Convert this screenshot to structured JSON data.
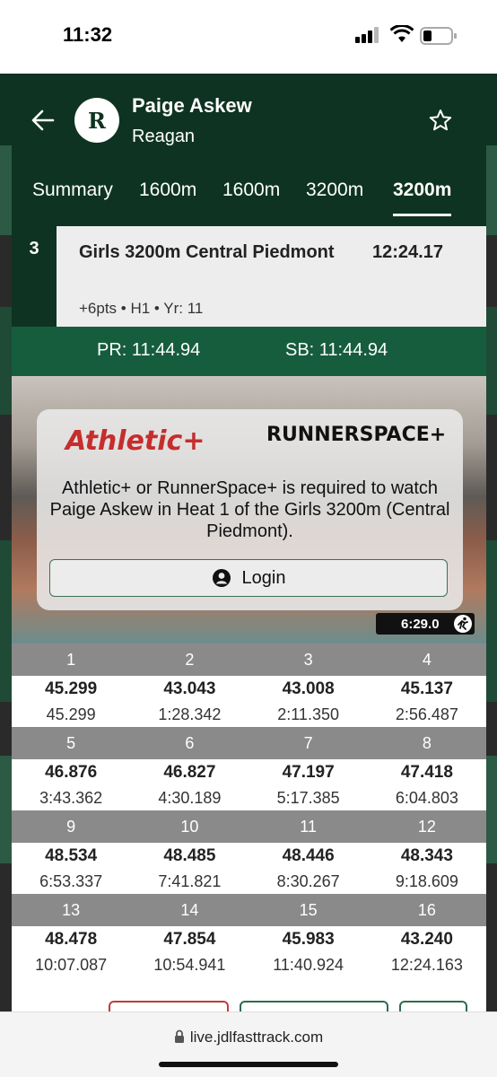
{
  "status_bar": {
    "time": "11:32"
  },
  "header": {
    "athlete_name": "Paige Askew",
    "team": "Reagan",
    "logo_letter": "R"
  },
  "tabs": [
    {
      "label": "Summary",
      "active": false
    },
    {
      "label": "1600m",
      "active": false
    },
    {
      "label": "1600m",
      "active": false
    },
    {
      "label": "3200m",
      "active": false
    },
    {
      "label": "3200m",
      "active": true
    }
  ],
  "result": {
    "place": "3",
    "event": "Girls 3200m Central Piedmont",
    "time": "12:24.17",
    "meta": "+6pts • H1 • Yr: 11"
  },
  "records": {
    "pr": "PR: 11:44.94",
    "sb": "SB: 11:44.94"
  },
  "video": {
    "athletic_logo": "Athletic+",
    "runnerspace_logo": "RUNNERSPACE+",
    "paywall_message": "Athletic+ or RunnerSpace+ is required to watch Paige Askew in  Heat 1 of the Girls 3200m (Central Piedmont).",
    "login_label": "Login",
    "duration": "6:29.0"
  },
  "splits": [
    {
      "laps": [
        "1",
        "2",
        "3",
        "4"
      ],
      "lap_times": [
        "45.299",
        "43.043",
        "43.008",
        "45.137"
      ],
      "cumulative": [
        "45.299",
        "1:28.342",
        "2:11.350",
        "2:56.487"
      ]
    },
    {
      "laps": [
        "5",
        "6",
        "7",
        "8"
      ],
      "lap_times": [
        "46.876",
        "46.827",
        "47.197",
        "47.418"
      ],
      "cumulative": [
        "3:43.362",
        "4:30.189",
        "5:17.385",
        "6:04.803"
      ]
    },
    {
      "laps": [
        "9",
        "10",
        "11",
        "12"
      ],
      "lap_times": [
        "48.534",
        "48.485",
        "48.446",
        "48.343"
      ],
      "cumulative": [
        "6:53.337",
        "7:41.821",
        "8:30.267",
        "9:18.609"
      ]
    },
    {
      "laps": [
        "13",
        "14",
        "15",
        "16"
      ],
      "lap_times": [
        "48.478",
        "47.854",
        "45.983",
        "43.240"
      ],
      "cumulative": [
        "10:07.087",
        "10:54.941",
        "11:40.924",
        "12:24.163"
      ]
    }
  ],
  "browser": {
    "url": "live.jdlfasttrack.com"
  },
  "colors": {
    "header_green": "#0e3322",
    "pr_green": "#165d3e",
    "split_header_gray": "#8a8a8a",
    "athletic_red": "#c62d2d"
  }
}
